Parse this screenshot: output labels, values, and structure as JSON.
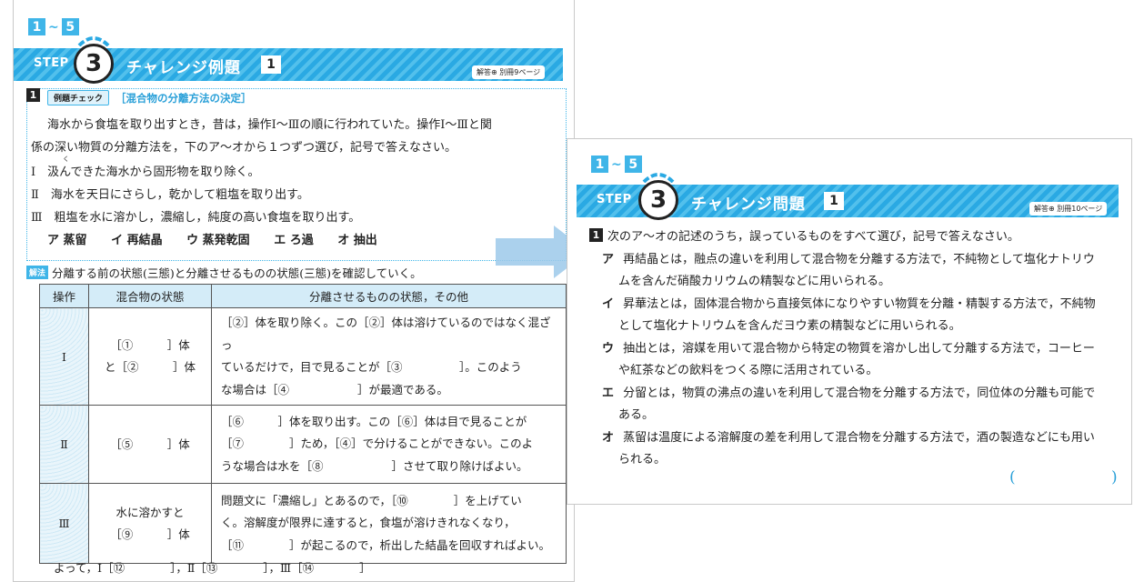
{
  "left": {
    "range": {
      "from": "1",
      "sep": "~",
      "to": "5"
    },
    "banner": {
      "step": "STEP",
      "step_num": "3",
      "title": "チャレンジ例題",
      "num": "1",
      "ref": "解答⊕ 別冊9ページ"
    },
    "problem": {
      "qnum": "1",
      "tag": "例題チェック",
      "tag_title": "［混合物の分離方法の決定］",
      "lines": [
        "海水から食塩を取り出すとき，昔は，操作Ⅰ～Ⅲの順に行われていた。操作Ⅰ～Ⅲと関",
        "係の深い物質の分離方法を，下のア～オから１つずつ選び，記号で答えなさい。",
        "Ⅰ　汲んできた海水から固形物を取り除く。",
        "Ⅱ　海水を天日にさらし，乾かして粗塩を取り出す。",
        "Ⅲ　粗塩を水に溶かし，濃縮し，純度の高い食塩を取り出す。"
      ],
      "ruby": "く",
      "choices": [
        "ア 蒸留",
        "イ 再結晶",
        "ウ 蒸発乾固",
        "エ ろ過",
        "オ 抽出"
      ]
    },
    "kaihou": {
      "tag": "解法",
      "text": "分離する前の状態(三態)と分離させるものの状態(三態)を確認していく。"
    },
    "table": {
      "headers": [
        "操作",
        "混合物の状態",
        "分離させるものの状態，その他"
      ],
      "rows": [
        {
          "op": "Ⅰ",
          "state": [
            "［①　　　］体",
            "と［②　　　］体"
          ],
          "desc": [
            "［②］体を取り除く。この［②］体は溶けているのではなく混ざっ",
            "ているだけで，目で見ることが［③　　　　　］。このよう",
            "な場合は［④　　　　　　］が最適である。"
          ]
        },
        {
          "op": "Ⅱ",
          "state": [
            "［⑤　　　］体"
          ],
          "desc": [
            "［⑥　　　］体を取り出す。この［⑥］体は目で見ることが",
            "［⑦　　　　］ため，［④］で分けることができない。このよ",
            "うな場合は水を［⑧　　　　　　］させて取り除けばよい。"
          ]
        },
        {
          "op": "Ⅲ",
          "state": [
            "水に溶かすと",
            "［⑨　　　］体"
          ],
          "desc": [
            "問題文に「濃縮し」とあるので，［⑩　　　　］を上げてい",
            "く。溶解度が限界に達すると，食塩が溶けきれなくなり，",
            "［⑪　　　　］が起こるので，析出した結晶を回収すればよい。"
          ]
        }
      ]
    },
    "conclusion": "よって，Ⅰ［⑫　　　　］，Ⅱ［⑬　　　　］，Ⅲ［⑭　　　　］"
  },
  "right": {
    "range": {
      "from": "1",
      "sep": "~",
      "to": "5"
    },
    "banner": {
      "step": "STEP",
      "step_num": "3",
      "title": "チャレンジ問題",
      "num": "1",
      "ref": "解答⊕ 別冊10ページ"
    },
    "qnum": "1",
    "question": "次のア～オの記述のうち，誤っているものをすべて選び，記号で答えなさい。",
    "options": [
      {
        "mark": "ア",
        "lines": [
          "再結晶とは，融点の違いを利用して混合物を分離する方法で，不純物として塩化ナトリウ",
          "ムを含んだ硝酸カリウムの精製などに用いられる。"
        ]
      },
      {
        "mark": "イ",
        "lines": [
          "昇華法とは，固体混合物から直接気体になりやすい物質を分離・精製する方法で，不純物",
          "として塩化ナトリウムを含んだヨウ素の精製などに用いられる。"
        ]
      },
      {
        "mark": "ウ",
        "lines": [
          "抽出とは，溶媒を用いて混合物から特定の物質を溶かし出して分離する方法で，コーヒー",
          "や紅茶などの飲料をつくる際に活用されている。"
        ]
      },
      {
        "mark": "エ",
        "lines": [
          "分留とは，物質の沸点の違いを利用して混合物を分離する方法で，同位体の分離も可能で",
          "ある。"
        ]
      },
      {
        "mark": "オ",
        "lines": [
          "蒸留は温度による溶解度の差を利用して混合物を分離する方法で，酒の製造などにも用い",
          "られる。"
        ]
      }
    ],
    "answer_open": "(",
    "answer_close": ")"
  },
  "colors": {
    "accent": "#2aa9e3",
    "accent_light": "#d4ecf8",
    "text": "#222222"
  }
}
